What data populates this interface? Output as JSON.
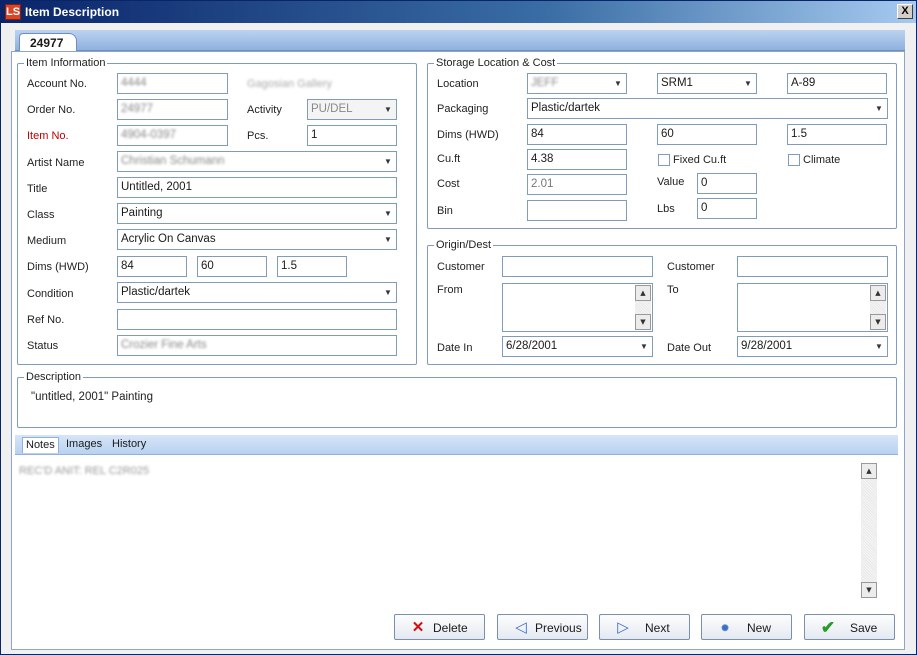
{
  "window": {
    "title": "Item Description",
    "app_icon": "LS",
    "close_label": "X"
  },
  "record_tab": "24977",
  "item_info": {
    "legend": "Item Information",
    "account_label": "Account No.",
    "account_value": "4444",
    "account_name": "Gagosian Gallery",
    "order_label": "Order No.",
    "order_value": "24977",
    "activity_label": "Activity",
    "activity_value": "PU/DEL",
    "item_label": "Item No.",
    "item_value": "4904-0397",
    "pcs_label": "Pcs.",
    "pcs_value": "1",
    "artist_label": "Artist Name",
    "artist_value": "Christian Schumann",
    "title_label": "Title",
    "title_value": "Untitled, 2001",
    "class_label": "Class",
    "class_value": "Painting",
    "medium_label": "Medium",
    "medium_value": "Acrylic On Canvas",
    "dims_label": "Dims (HWD)",
    "dims_h": "84",
    "dims_w": "60",
    "dims_d": "1.5",
    "condition_label": "Condition",
    "condition_value": "Plastic/dartek",
    "ref_label": "Ref No.",
    "ref_value": "",
    "status_label": "Status",
    "status_value": "Crozier Fine Arts"
  },
  "storage": {
    "legend": "Storage Location & Cost",
    "location_label": "Location",
    "location_value": "JEFF",
    "location2_value": "SRM1",
    "location3_value": "A-89",
    "packaging_label": "Packaging",
    "packaging_value": "Plastic/dartek",
    "dims_label": "Dims (HWD)",
    "dims_h": "84",
    "dims_w": "60",
    "dims_d": "1.5",
    "cuft_label": "Cu.ft",
    "cuft_value": "4.38",
    "fixed_cuft_label": "Fixed Cu.ft",
    "climate_label": "Climate",
    "cost_label": "Cost",
    "cost_value": "2.01",
    "value_label": "Value",
    "value_value": "0",
    "bin_label": "Bin",
    "bin_value": "",
    "lbs_label": "Lbs",
    "lbs_value": "0"
  },
  "origin": {
    "legend": "Origin/Dest",
    "customer_label": "Customer",
    "customer_value": "",
    "customer2_label": "Customer",
    "customer2_value": "",
    "from_label": "From",
    "to_label": "To",
    "date_in_label": "Date In",
    "date_in_value": "6/28/2001",
    "date_out_label": "Date Out",
    "date_out_value": "9/28/2001"
  },
  "description": {
    "legend": "Description",
    "text": "\"untitled, 2001\" Painting"
  },
  "notes_tabs": [
    "Notes",
    "Images",
    "History"
  ],
  "notes_text": "REC'D ANIT: REL C2R025",
  "buttons": {
    "delete": "Delete",
    "previous": "Previous",
    "next": "Next",
    "new": "New",
    "save": "Save"
  },
  "icons": {
    "app": "app-logo-icon",
    "delete": "red-x-icon",
    "previous": "arrow-left-icon",
    "next": "arrow-right-icon",
    "new": "new-badge-icon",
    "save": "green-check-icon"
  },
  "colors": {
    "title_start": "#0a246a",
    "label_red": "#c00000",
    "delete_icon": "#d01010",
    "save_icon": "#2a9a2a",
    "nav_icon": "#3a6fc4"
  }
}
